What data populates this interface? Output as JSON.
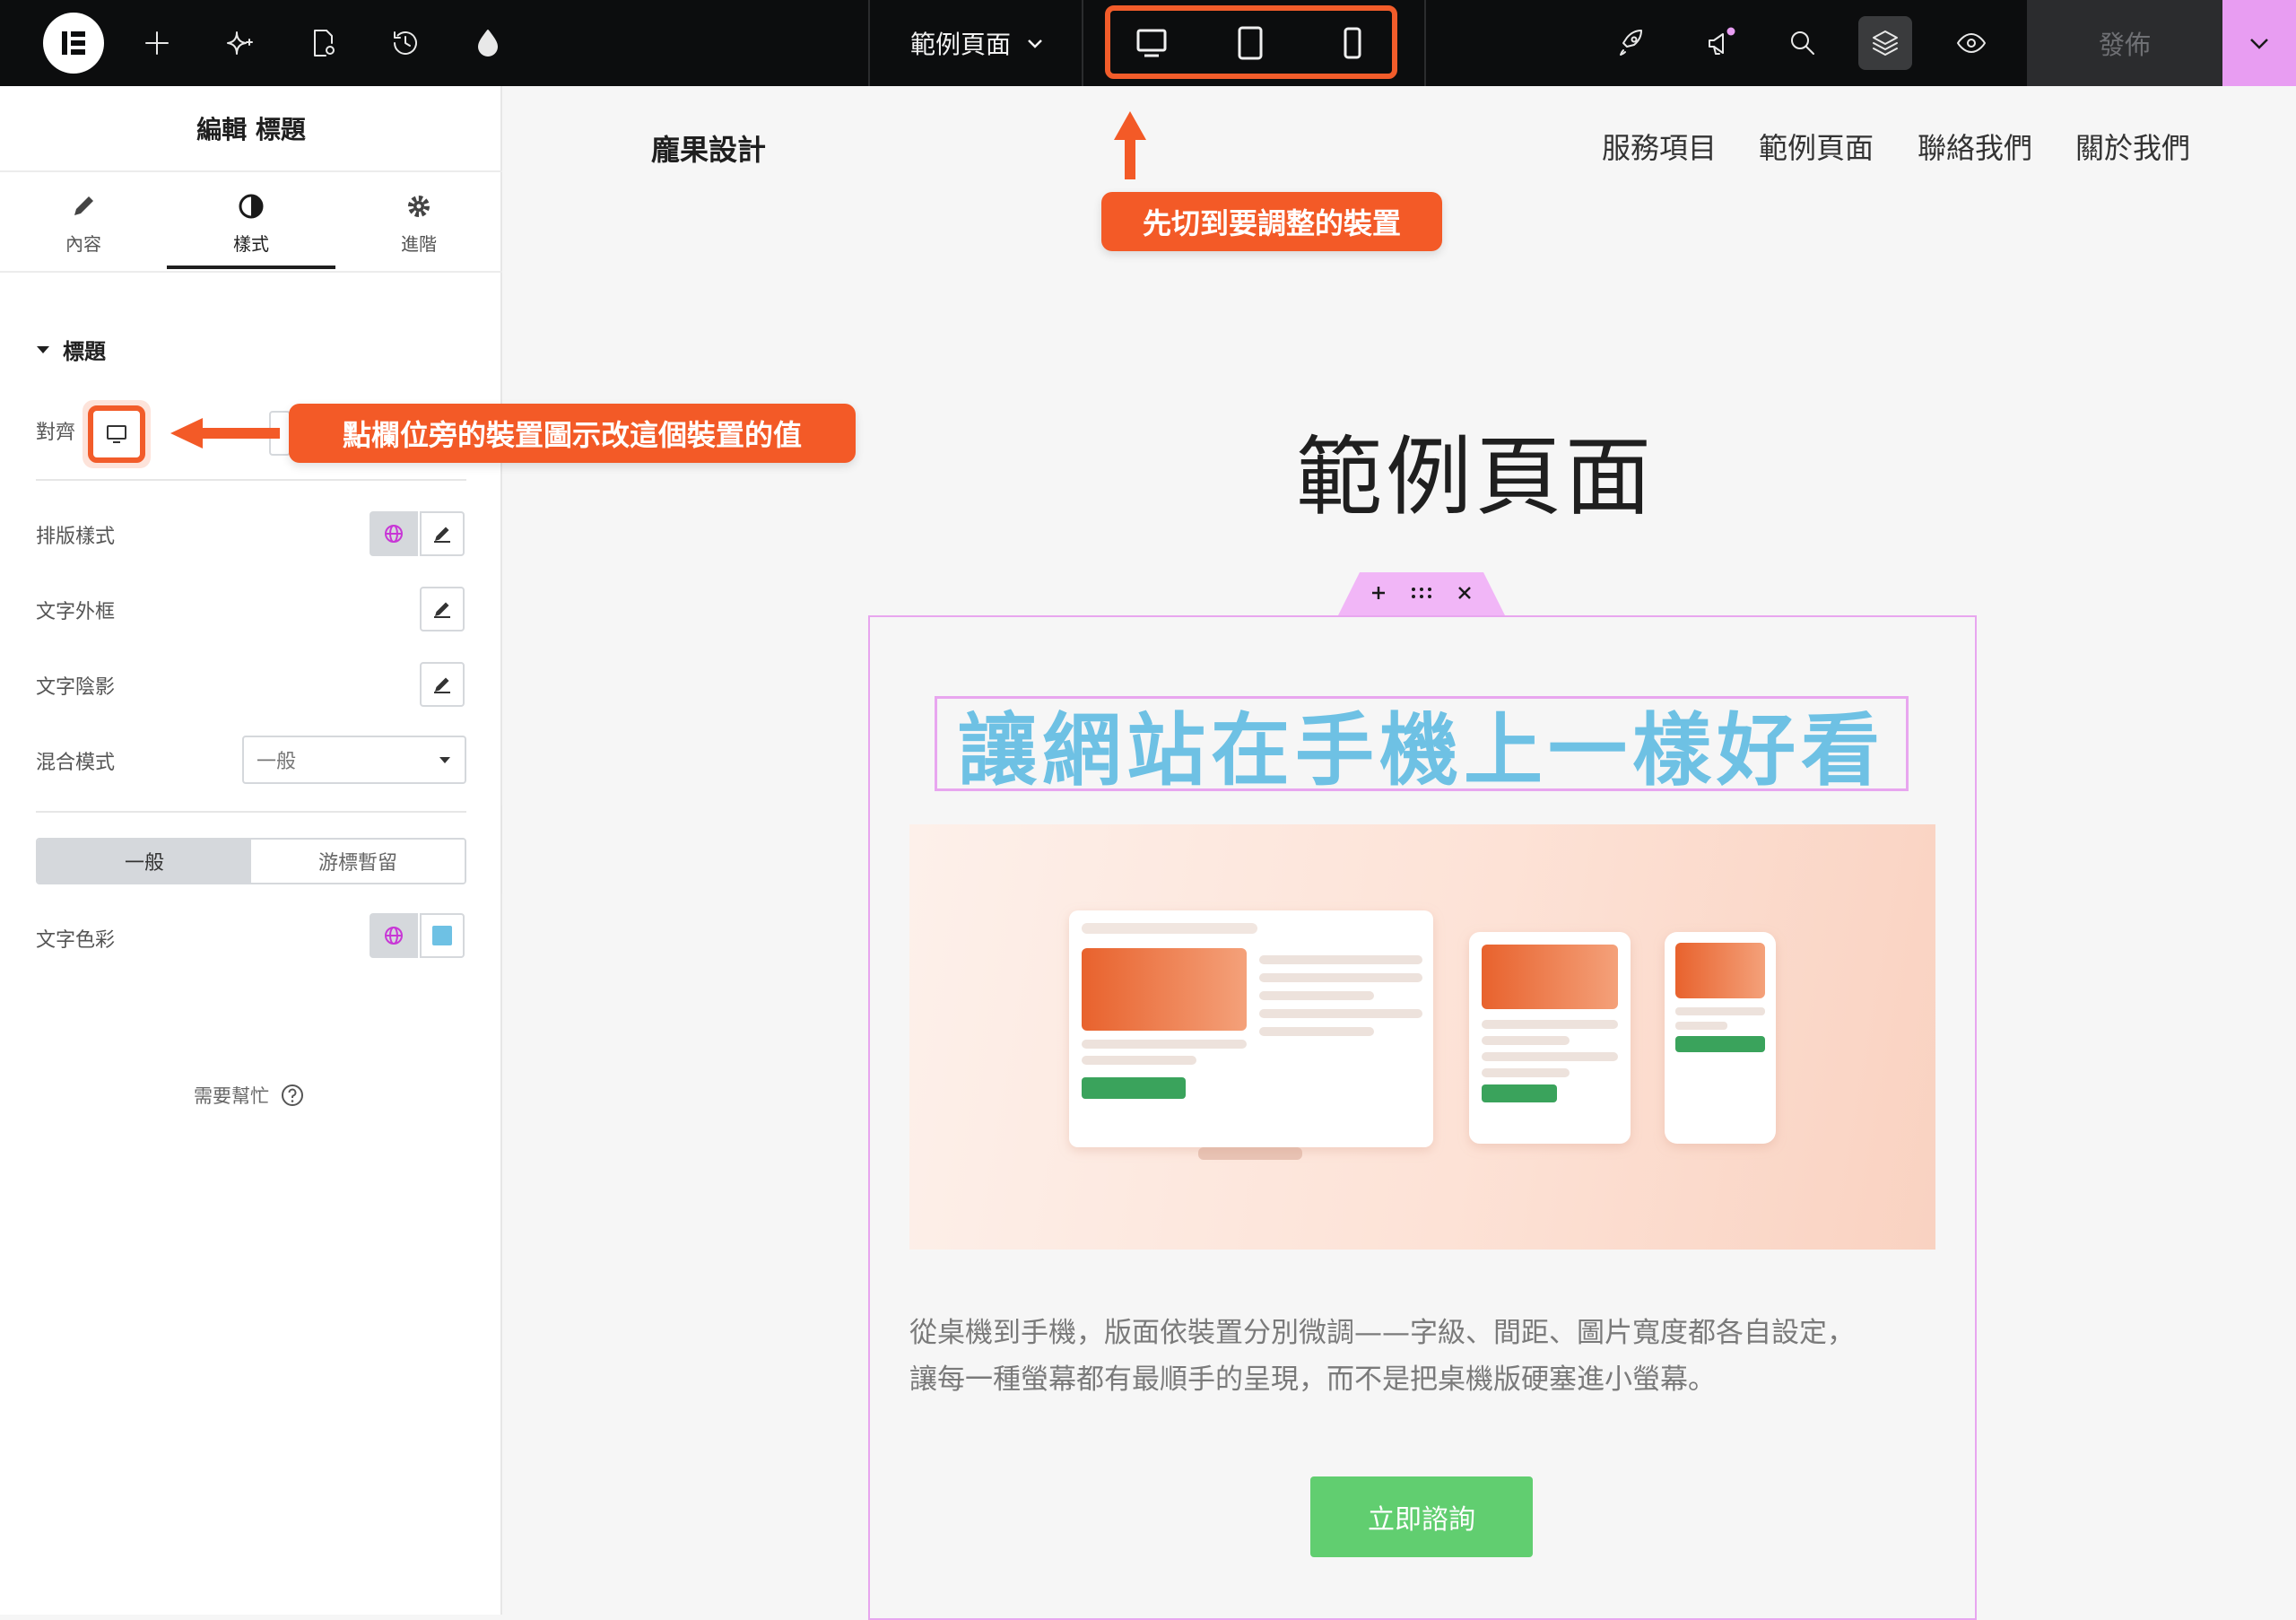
{
  "topbar": {
    "page_title": "範例頁面",
    "publish_label": "發佈"
  },
  "panel": {
    "title": "編輯 標題",
    "tabs": [
      {
        "label": "內容",
        "icon": "pencil-icon"
      },
      {
        "label": "樣式",
        "icon": "half-circle-icon",
        "active": true
      },
      {
        "label": "進階",
        "icon": "gear-icon"
      }
    ],
    "section_title": "標題",
    "controls": {
      "align": "對齊",
      "typography": "排版樣式",
      "text_stroke": "文字外框",
      "text_shadow": "文字陰影",
      "blend_mode": "混合模式",
      "blend_mode_value": "一般",
      "state_normal": "一般",
      "state_hover": "游標暫留",
      "text_color": "文字色彩",
      "text_color_value": "#6ec1e4"
    },
    "help": "需要幫忙"
  },
  "site": {
    "brand": "龐果設計",
    "nav": [
      "服務項目",
      "範例頁面",
      "聯絡我們",
      "關於我們"
    ],
    "page_heading": "範例頁面",
    "headline": "讓網站在手機上一樣好看",
    "body_line1": "從桌機到手機，版面依裝置分別微調——字級、間距、圖片寬度都各自設定，",
    "body_line2": "讓每一種螢幕都有最順手的呈現，而不是把桌機版硬塞進小螢幕。",
    "cta": "立即諮詢"
  },
  "annotations": {
    "device_switch": "先切到要調整的裝置",
    "field_device_icon": "點欄位旁的裝置圖示改這個裝置的值"
  },
  "colors": {
    "accent": "#f35a27",
    "headline": "#6ec1e4",
    "cta": "#61ce70",
    "selection": "#e8a6ef"
  }
}
